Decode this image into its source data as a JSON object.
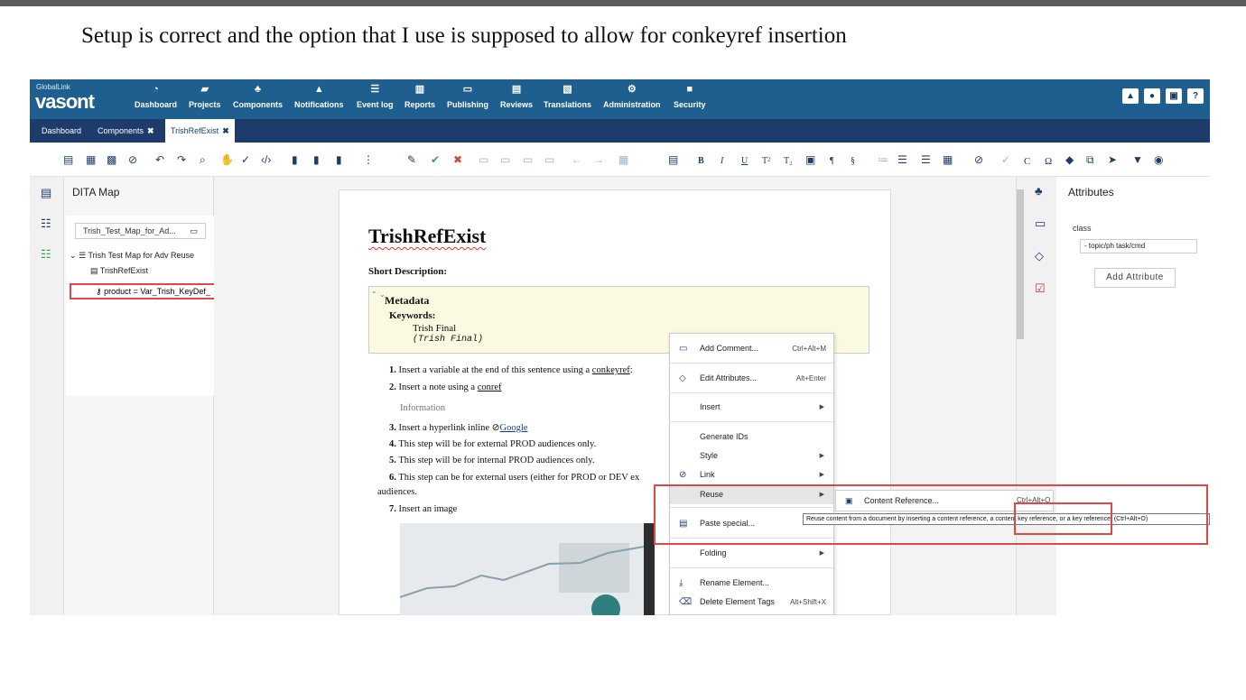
{
  "caption": "Setup is correct and the option that I use is supposed to allow for conkeyref insertion",
  "brand": {
    "small": "GlobalLink",
    "big": "vasont"
  },
  "nav": [
    {
      "label": "Dashboard",
      "icon": "dashboard-icon",
      "glyph": "◔"
    },
    {
      "label": "Projects",
      "icon": "folder-icon",
      "glyph": "▰"
    },
    {
      "label": "Components",
      "icon": "components-icon",
      "glyph": "♣"
    },
    {
      "label": "Notifications",
      "icon": "bell-icon",
      "glyph": "▲"
    },
    {
      "label": "Event log",
      "icon": "list-icon",
      "glyph": "☰"
    },
    {
      "label": "Reports",
      "icon": "chart-icon",
      "glyph": "▥"
    },
    {
      "label": "Publishing",
      "icon": "monitor-icon",
      "glyph": "▭"
    },
    {
      "label": "Reviews",
      "icon": "review-icon",
      "glyph": "▤"
    },
    {
      "label": "Translations",
      "icon": "translate-icon",
      "glyph": "▧"
    },
    {
      "label": "Administration",
      "icon": "gears-icon",
      "glyph": "⚙"
    },
    {
      "label": "Security",
      "icon": "lock-icon",
      "glyph": "■"
    }
  ],
  "nav_right": {
    "help": "?"
  },
  "tabs": [
    {
      "label": "Dashboard",
      "close": ""
    },
    {
      "label": "Components",
      "close": "✖"
    },
    {
      "label": "TrishRefExist",
      "close": "✖"
    }
  ],
  "toolbar": {
    "bold": "B",
    "italic": "I",
    "underline": "U",
    "superscript": "T²",
    "subscript": "T₂",
    "para": "¶",
    "section": "§",
    "omega": "Ω",
    "copyright": "C"
  },
  "left_panel": {
    "title": "DITA Map",
    "map_select": "Trish_Test_Map_for_Ad...",
    "tree_root": "Trish Test Map for Adv Reuse",
    "tree_topic": "TrishRefExist",
    "tree_keydef": "product = Var_Trish_KeyDef_"
  },
  "document": {
    "title": "TrishRefExist",
    "short_desc": "Short Description:",
    "metadata_label": "Metadata",
    "keywords_label": "Keywords:",
    "keyword": "Trish Final",
    "keyword_code": "(Trish Final)",
    "steps": [
      {
        "num": "1.",
        "pre": "Insert a variable at the end of this sentence using a ",
        "link": "conkeyref",
        "post": ":"
      },
      {
        "num": "2.",
        "pre": "Insert a note using a ",
        "link": "conref",
        "post": ""
      },
      {
        "num": "3.",
        "pre": "Insert a hyperlink inline ",
        "link": "Google",
        "post": ""
      },
      {
        "num": "4.",
        "pre": "This step will be for external PROD audiences only.",
        "link": "",
        "post": ""
      },
      {
        "num": "5.",
        "pre": "This step will be for internal PROD audiences only.",
        "link": "",
        "post": ""
      },
      {
        "num": "6.",
        "pre": "This step can be for external users (either for PROD or DEV ex",
        "link": "",
        "post": ""
      },
      {
        "num": "",
        "pre": "audiences.",
        "link": "",
        "post": ""
      },
      {
        "num": "7.",
        "pre": "Insert an image",
        "link": "",
        "post": ""
      }
    ],
    "note_label": "Information"
  },
  "attributes": {
    "title": "Attributes",
    "class_label": "class",
    "class_value": "- topic/ph task/cmd",
    "add_button": "Add Attribute"
  },
  "context_menu": {
    "add_comment": "Add Comment...",
    "add_comment_sc": "Ctrl+Alt+M",
    "edit_attributes": "Edit Attributes...",
    "edit_attributes_sc": "Alt+Enter",
    "insert": "Insert",
    "generate_ids": "Generate IDs",
    "style": "Style",
    "link": "Link",
    "reuse": "Reuse",
    "paste_special": "Paste special...",
    "folding": "Folding",
    "rename": "Rename Element...",
    "delete_tags": "Delete Element Tags",
    "delete_tags_sc": "Alt+Shift+X"
  },
  "submenu": {
    "content_reference": "Content Reference...",
    "shortcut": "Ctrl+Alt+O"
  },
  "tooltip": "Reuse content from a document by inserting a content reference, a content key reference, or a key reference. (Ctrl+Alt+O)",
  "colors": {
    "nav_bg": "#1e5f8f",
    "tab_bg": "#1e3c6b",
    "highlight_box": "#e04848",
    "metadata_bg": "#fbf9e0"
  }
}
